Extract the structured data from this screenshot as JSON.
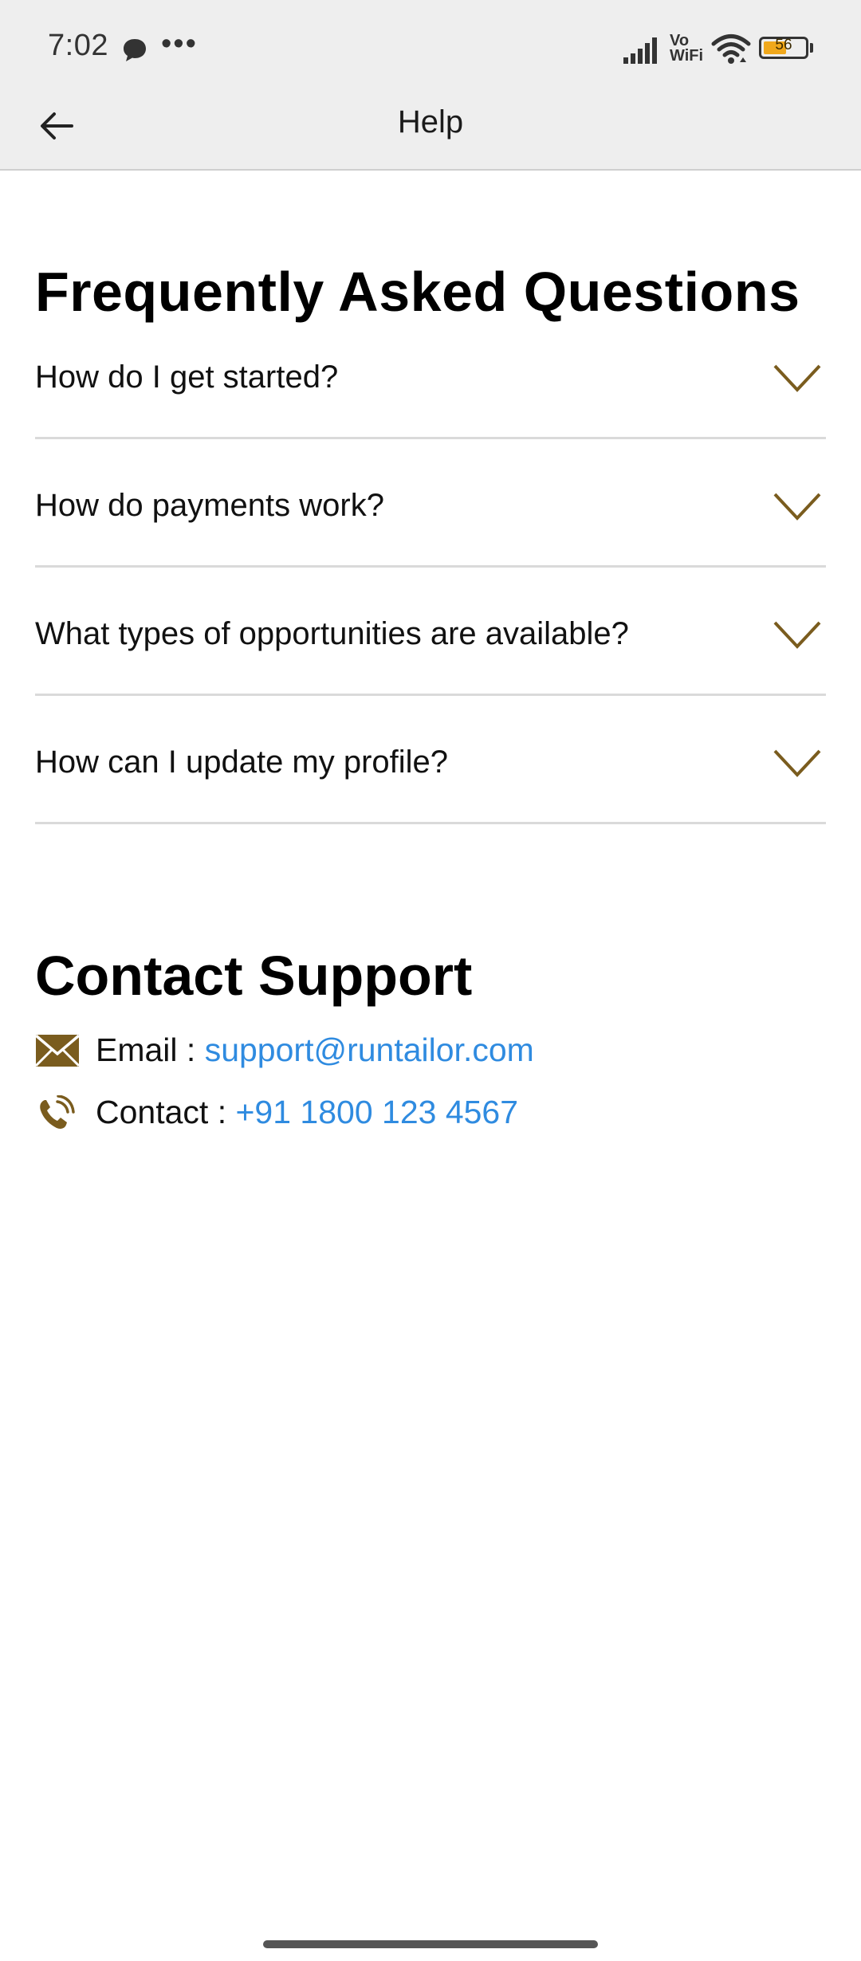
{
  "status_bar": {
    "time": "7:02",
    "more": "•••",
    "network_label_top": "Vo",
    "network_label_bottom": "WiFi",
    "battery_level": "56"
  },
  "app_bar": {
    "title": "Help",
    "back_icon": "arrow-left-icon"
  },
  "faq": {
    "heading": "Frequently Asked Questions",
    "items": [
      {
        "question": "How do I get started?",
        "expanded": false
      },
      {
        "question": "How do payments work?",
        "expanded": false
      },
      {
        "question": "What types of opportunities are available?",
        "expanded": false
      },
      {
        "question": "How can I update my profile?",
        "expanded": false
      }
    ]
  },
  "support": {
    "heading": "Contact Support",
    "email": {
      "label": "Email : ",
      "value": "support@runtailor.com",
      "icon": "envelope-icon"
    },
    "phone": {
      "label": "Contact : ",
      "value": "+91 1800 123 4567",
      "icon": "phone-icon"
    }
  },
  "colors": {
    "accent_gold": "#7a5c1e",
    "link_blue": "#2f8be0",
    "battery_fill": "#f0a81c"
  }
}
